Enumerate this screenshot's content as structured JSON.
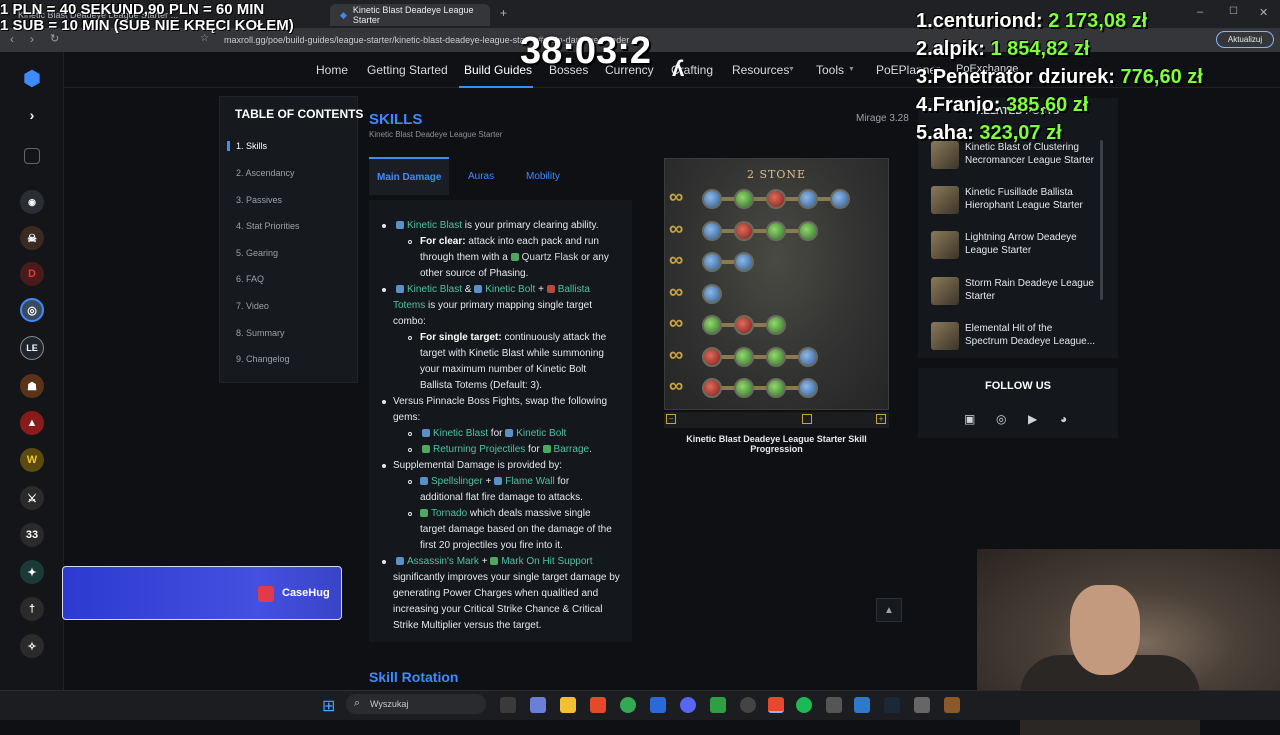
{
  "overlay": {
    "info_line1": "1 PLN = 40 SEKUND,90 PLN = 60 MIN",
    "info_line2": "1 SUB = 10 MIN (SUB NIE KRĘCI KOŁEM)",
    "timer": "38:03:2",
    "donors": [
      {
        "rank": "1.",
        "name": "centuriond:",
        "amount": "2 173,08 zł"
      },
      {
        "rank": "2.",
        "name": "alpik:",
        "amount": "1 854,82 zł"
      },
      {
        "rank": "3.",
        "name": "Penetrator dziurek:",
        "amount": "776,60 zł"
      },
      {
        "rank": "4.",
        "name": "Franio:",
        "amount": "385,60 zł"
      },
      {
        "rank": "5.",
        "name": "aha:",
        "amount": "323,07 zł"
      }
    ]
  },
  "browser": {
    "tabs": [
      "Kinetic Blast Deadeye League Starter ...",
      "Kinetic Blast Deadeye League Starter"
    ],
    "url": "maxroll.gg/poe/build-guides/league-starter/kinetic-blast-deadeye-league-starter#main-damage-header",
    "update_label": "Aktualizuj"
  },
  "nav": {
    "items": [
      "Home",
      "Getting Started",
      "Build Guides",
      "Bosses",
      "Currency",
      "Crafting",
      "Resources",
      "Tools",
      "PoEPlanner",
      "PoExchange"
    ],
    "active": "Build Guides"
  },
  "toc": {
    "title": "TABLE OF CONTENTS",
    "items": [
      "1. Skills",
      "2. Ascendancy",
      "3. Passives",
      "4. Stat Priorities",
      "5. Gearing",
      "6. FAQ",
      "7. Video",
      "8. Summary",
      "9. Changelog"
    ]
  },
  "skills": {
    "title": "SKILLS",
    "subtitle": "Kinetic Blast Deadeye League Starter",
    "version": "Mirage 3.28",
    "tabs": [
      "Main Damage",
      "Auras",
      "Mobility"
    ],
    "lines": {
      "l1a": "Kinetic Blast",
      "l1b": " is your primary clearing ability.",
      "l2a": "For clear:",
      "l2b": " attack into each pack and run",
      "l3a": "through them with a ",
      "l3b": "Quartz Flask",
      "l3c": " or any",
      "l4": "other source of Phasing.",
      "l5a": "Kinetic Blast",
      "l5b": " & ",
      "l5c": "Kinetic Bolt",
      "l5d": " + ",
      "l5e": "Ballista",
      "l6a": "Totems",
      "l6b": " is your primary mapping single target",
      "l7": "combo:",
      "l8a": "For single target:",
      "l8b": " continuously attack the",
      "l9": "target with Kinetic Blast while summoning",
      "l10": "your maximum number of Kinetic Bolt",
      "l11": "Ballista Totems (Default: 3).",
      "l12": "Versus Pinnacle Boss Fights, swap the following",
      "l13": "gems:",
      "l14a": "Kinetic Blast",
      "l14b": " for ",
      "l14c": "Kinetic Bolt",
      "l15a": "Returning Projectiles",
      "l15b": " for ",
      "l15c": "Barrage",
      "l15d": ".",
      "l16": "Supplemental Damage is provided by:",
      "l17a": "Spellslinger",
      "l17b": " + ",
      "l17c": "Flame Wall",
      "l17d": " for",
      "l18": "additional flat fire damage to attacks.",
      "l19a": "Tornado",
      "l19b": " which deals massive single",
      "l20": "target damage based on the damage of the",
      "l21": "first 20 projectiles you fire into it.",
      "l22a": "Assassin's Mark",
      "l22b": " + ",
      "l22c": "Mark On Hit Support",
      "l23": "significantly improves your single target damage by",
      "l24": "generating Power Charges when qualitied and",
      "l25": "increasing your Critical Strike Chance & Critical",
      "l26": "Strike Multiplier versus the target."
    },
    "rotation_title": "Skill Rotation"
  },
  "progression": {
    "title": "2 STONE",
    "caption": "Kinetic Blast Deadeye League Starter Skill Progression",
    "rows": [
      [
        "b",
        "g",
        "r",
        "b",
        "b"
      ],
      [
        "b",
        "r",
        "g",
        "g"
      ],
      [
        "b",
        "b"
      ],
      [
        "b"
      ],
      [
        "g",
        "r",
        "g"
      ],
      [
        "r",
        "g",
        "g",
        "b"
      ],
      [
        "r",
        "g",
        "g",
        "b"
      ]
    ],
    "link_icon": "∞"
  },
  "related": {
    "header": "RELATED POSTS",
    "posts": [
      "Kinetic Blast of Clustering Necromancer League Starter",
      "Kinetic Fusillade Ballista Hierophant League Starter",
      "Lightning Arrow Deadeye League Starter",
      "Storm Rain Deadeye League Starter",
      "Elemental Hit of the Spectrum Deadeye League..."
    ]
  },
  "follow": {
    "title": "FOLLOW US",
    "icons": [
      "twitch-icon",
      "instagram-icon",
      "youtube-icon",
      "discord-icon"
    ]
  },
  "ad": {
    "label": "CaseHug"
  },
  "taskbar": {
    "search_placeholder": "Wyszukaj"
  }
}
